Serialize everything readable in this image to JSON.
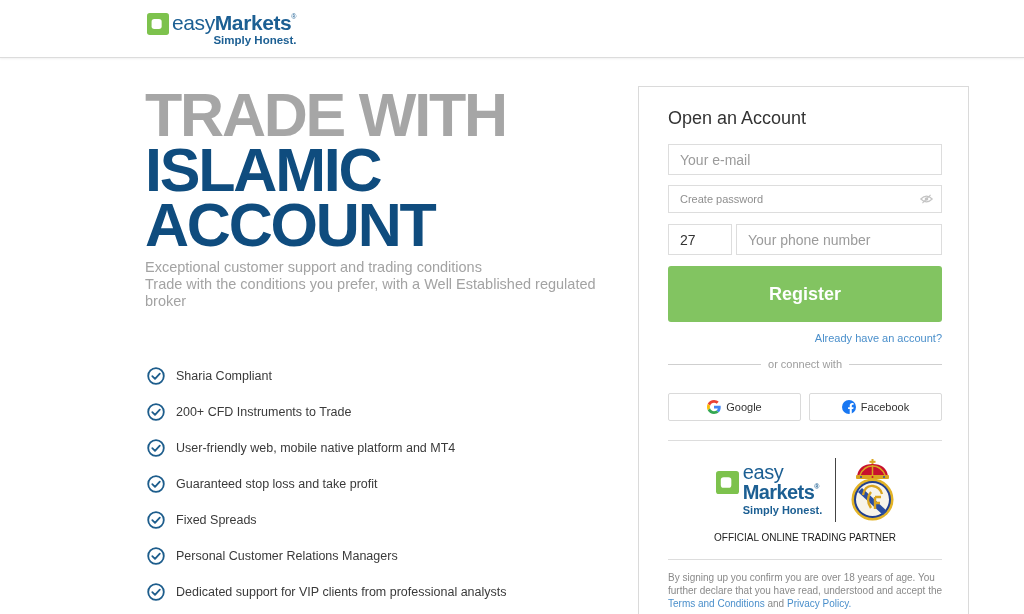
{
  "header": {
    "logo": {
      "wordmark": "easy**Markets**$^{®}$",
      "tagline": "Simply Honest."
    }
  },
  "hero": {
    "headline": [
      {
        "text": "TRADE WITH",
        "color": "#a6a6a6"
      },
      {
        "text": "ISLAMIC",
        "color": "#0f4c7e"
      },
      {
        "text": "ACCOUNT",
        "color": "#0f4c7e"
      }
    ],
    "subtitle": [
      "Exceptional customer support and trading conditions",
      "Trade with the conditions you prefer, with a Well Established regulated broker"
    ],
    "features": [
      "Sharia Compliant",
      "200+ CFD Instruments to Trade",
      "User-friendly web, mobile native platform and MT4",
      "Guaranteed stop loss and take profit",
      "Fixed Spreads",
      "Personal Customer Relations Managers",
      "Dedicated support for VIP clients from professional analysts"
    ]
  },
  "signup": {
    "title": "Open an Account",
    "email": {
      "placeholder": "Your e-mail"
    },
    "password": {
      "placeholder": "Create password"
    },
    "phone": {
      "country_code": "27",
      "placeholder": "Your phone number"
    },
    "register_button": "Register",
    "login_link": "Already have an account?",
    "divider": "or connect with",
    "social_buttons": [
      {
        "kind": "google",
        "label": "Google"
      },
      {
        "kind": "facebook",
        "label": "Facebook"
      }
    ],
    "partner": {
      "word_top": "easy",
      "word_bottom": "Markets$^{®}$",
      "tagline": "Simply Honest.",
      "caption": "OFFICIAL ONLINE TRADING PARTNER"
    },
    "legal": [
      {
        "kind": "text",
        "text": "By signing up you confirm you are over 18 years of age. You further declare that you have read, understood and accept the "
      },
      {
        "kind": "link",
        "text": "Terms and Conditions"
      },
      {
        "kind": "text",
        "text": " and "
      },
      {
        "kind": "link",
        "text": "Privacy Policy."
      }
    ]
  }
}
